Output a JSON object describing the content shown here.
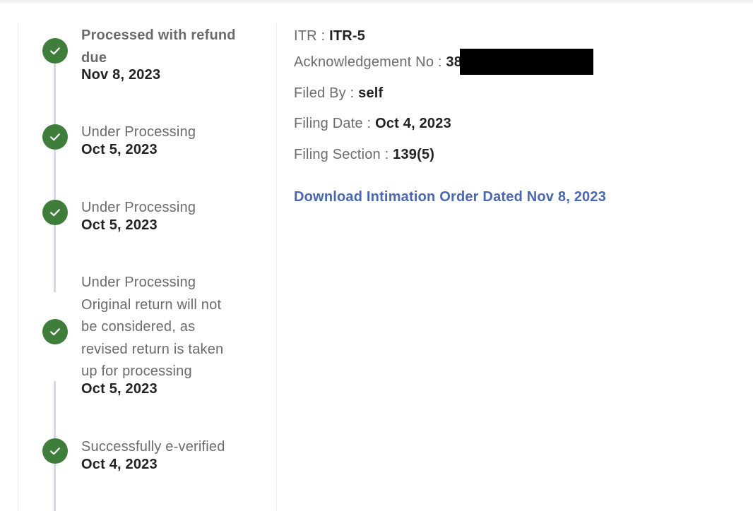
{
  "timeline": [
    {
      "status": "Processed with refund due",
      "date": "Nov 8, 2023"
    },
    {
      "status": "Under Processing",
      "date": "Oct 5, 2023"
    },
    {
      "status": "Under Processing",
      "date": "Oct 5, 2023"
    },
    {
      "status": "Under Processing",
      "note": "Original return will not be considered, as revised return is taken up for processing",
      "date": "Oct 5, 2023"
    },
    {
      "status": "Successfully e-verified",
      "date": "Oct 4, 2023"
    }
  ],
  "details": {
    "itr_label": "ITR : ",
    "itr_value": "ITR-5",
    "ack_label": "Acknowledgement No : ",
    "ack_value": "38",
    "filed_by_label": "Filed By : ",
    "filed_by_value": "self",
    "filing_date_label": "Filing Date : ",
    "filing_date_value": "Oct 4, 2023",
    "filing_section_label": "Filing Section : ",
    "filing_section_value": "139(5)",
    "download_link": "Download Intimation Order Dated Nov 8, 2023"
  },
  "colors": {
    "check_green": "#3f7d3a",
    "link_blue": "#4a67b5",
    "timeline_line": "#d8d8e4"
  },
  "icons": {
    "status": "check-circle-icon"
  }
}
